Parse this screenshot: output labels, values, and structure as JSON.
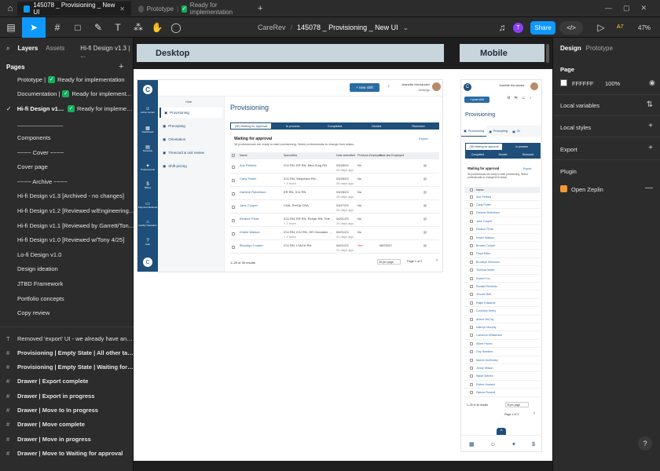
{
  "tabs": {
    "home_icon": "home-icon",
    "active": {
      "title": "145078 _ Provisioning _ New UI"
    },
    "second": {
      "title": "Prototype",
      "status": "Ready for implementation"
    },
    "add": "+"
  },
  "toolbar": {
    "breadcrumb_team": "CareRev",
    "breadcrumb_sep": "/",
    "file_name": "145078 _ Provisioning _ New UI",
    "share_label": "Share",
    "avatar_letter": "T",
    "ai_label": "A7",
    "zoom": "47%"
  },
  "left_panel": {
    "tab_layers": "Layers",
    "tab_assets": "Assets",
    "page_dropdown": "Hi-fi Design v1.3 | ...",
    "pages_heading": "Pages",
    "pages": [
      {
        "label": "Prototype | ",
        "status": "Ready for implementation",
        "check": true
      },
      {
        "label": "Documentation | ",
        "status": "Ready for implement...",
        "check": true
      },
      {
        "label": "Hi-fi Design v1.3 | ",
        "status": "Ready for implemen...",
        "check": true,
        "selected": true
      },
      {
        "label": "______________"
      },
      {
        "label": "Components"
      },
      {
        "label": "~~~~ Cover ~~~~"
      },
      {
        "label": "Cover page"
      },
      {
        "label": "~~~~ Archive ~~~~"
      },
      {
        "label": "Hi-fi Design v1.3 [Archived - no changes]"
      },
      {
        "label": "Hi-fi Design v1.2 [Reviewed w/Engineering..."
      },
      {
        "label": "Hi-fi Design v1.1 [Reviewed by Garrett/Ton..."
      },
      {
        "label": "Hi-fi Design v1.0 [Reviewed w/Tony 4/25]"
      },
      {
        "label": "Lo-fi Design v1.0"
      },
      {
        "label": "Design ideation"
      },
      {
        "label": "JTBD Framework"
      },
      {
        "label": "Portfolio concepts"
      },
      {
        "label": "Copy review"
      }
    ],
    "layers": [
      {
        "icon": "text-icon",
        "label": "Removed 'export' UI - we already have an ex..."
      },
      {
        "icon": "frame-icon",
        "label": "Provisioning | Empty State | All other tabs"
      },
      {
        "icon": "frame-icon",
        "label": "Provisioning | Empty State | Waiting for app..."
      },
      {
        "icon": "frame-icon",
        "label": "Drawer | Export complete"
      },
      {
        "icon": "frame-icon",
        "label": "Drawer | Export in progress"
      },
      {
        "icon": "frame-icon",
        "label": "Drawer | Move to In progress"
      },
      {
        "icon": "frame-icon",
        "label": "Drawer | Move complete"
      },
      {
        "icon": "frame-icon",
        "label": "Drawer | Move in progress"
      },
      {
        "icon": "frame-icon",
        "label": "Drawer | Move to Waiting for approval"
      }
    ]
  },
  "canvas": {
    "desktop_label": "Desktop",
    "mobile_label": "Mobile",
    "desktop": {
      "new_shift": "+ new shift",
      "user_name": "Jeanette Hernandez",
      "user_sub": "Settings",
      "hide": "Hide",
      "nav": [
        {
          "icon": "user-icon",
          "label": "Action Center"
        },
        {
          "icon": "grid-icon",
          "label": "Dashboard"
        },
        {
          "icon": "calendar-icon",
          "label": "Schedule"
        },
        {
          "icon": "people-icon",
          "label": "Professionals"
        },
        {
          "icon": "dollar-icon",
          "label": "Billing"
        },
        {
          "icon": "card-icon",
          "label": "Payment Methods"
        },
        {
          "icon": "building-icon",
          "label": "Facility Operation"
        },
        {
          "icon": "help-icon",
          "label": "Help"
        }
      ],
      "subnav": [
        "Provisioning",
        "Precepting",
        "Orientation",
        "Timecard & unit review",
        "Shift pricing"
      ],
      "title": "Provisioning",
      "tabs": [
        "(36) Waiting for approval",
        "In process",
        "Completed",
        "Denied",
        "Removed"
      ],
      "section_title": "Waiting for approval",
      "section_desc": "36 professionals are ready to start provisioning. Select professionals to change their status.",
      "export": "Export",
      "columns": [
        "Name",
        "Specialties",
        "Date submitted",
        "Previous Employee",
        "Date last Employed"
      ],
      "rows": [
        {
          "name": "Aric Perkins",
          "spec": "ICU RN, ER RN, Med-Surg RN",
          "date": "03/28/23",
          "ago": "20 days ago",
          "prev": "No",
          "last": ""
        },
        {
          "name": "Carly Potter",
          "spec": "ICU RN, Stepdown RN...",
          "more": "+ 3 more",
          "date": "03/28/23",
          "ago": "26 days ago",
          "prev": "No",
          "last": ""
        },
        {
          "name": "Darlene Robertson",
          "spec": "ER RN, ICU RN",
          "date": "03/28/23",
          "ago": "26 days ago",
          "prev": "No",
          "last": ""
        },
        {
          "name": "Jane Cooper",
          "spec": "CNA, PreOp CNA",
          "date": "03/27/23",
          "ago": "26 days ago",
          "prev": "No",
          "last": ""
        },
        {
          "name": "Eleanor Pena",
          "spec": "ICU RN, ER RN, Rehab RN, Tele RN...",
          "more": "+ 2 more",
          "date": "04/01/23",
          "ago": "21 days ago",
          "prev": "No",
          "last": ""
        },
        {
          "name": "Kristin Watson",
          "spec": "ICU RN, ICU RN, OR Circulator RN...",
          "more": "+ 2 more",
          "date": "04/01/23",
          "ago": "21 days ago",
          "prev": "No",
          "last": ""
        },
        {
          "name": "Brooklyn Cooper",
          "spec": "ICU RN, LTACH RN",
          "date": "04/01/23",
          "ago": "21 days ago",
          "prev": "Yes",
          "last": "08/23/22"
        }
      ],
      "results": "1–25 of 36 results",
      "per_page": "25 per page",
      "page_of": "Page 1 of 2"
    },
    "mobile": {
      "user_name": "Jeanette Hernandez",
      "post_shift": "+ post shift",
      "title": "Provisioning",
      "tabs": [
        "Provisioning",
        "Precepting",
        "Or"
      ],
      "status_tabs": [
        "(36) Waiting for approval",
        "In process",
        "Completed",
        "Denied",
        "Removed"
      ],
      "section_title": "Waiting for approval",
      "section_desc": "36 professionals are ready to start provisioning. Select professionals to change their status.",
      "export": "Export",
      "column": "Name",
      "names": [
        "Aric Perkins",
        "Carly Potter",
        "Darlene Robertson",
        "Jane Cooper",
        "Eleanor Pena",
        "Kristin Watson",
        "Brooke Cooper",
        "Floyd Miles",
        "Brooklyn Simmons",
        "Theresa Webb",
        "Robert Fox",
        "Ronald Richards",
        "Jerome Bell",
        "Ralph Edwards",
        "Courtney Henry",
        "Arlene McCoy",
        "Kathryn Murphy",
        "Cameron Williamson",
        "Albert Flores",
        "Guy Hawkins",
        "Marvin McKinney",
        "Jenny Wilson",
        "Wade Warren",
        "Esther Howard",
        "Dianne Russell"
      ],
      "results": "1–25 of 36 results",
      "per_page": "25 per page",
      "page_of": "Page 1 of 2"
    }
  },
  "right_panel": {
    "tab_design": "Design",
    "tab_prototype": "Prototype",
    "page_heading": "Page",
    "page_color": "FFFFFF",
    "page_opacity": "100%",
    "local_variables": "Local variables",
    "local_styles": "Local styles",
    "export": "Export",
    "plugin_heading": "Plugin",
    "plugin_name": "Open Zeplin",
    "help": "?"
  },
  "colors": {
    "accent": "#0d99ff",
    "brand": "#1e4e79",
    "frame_header": "#c7d5dd"
  }
}
